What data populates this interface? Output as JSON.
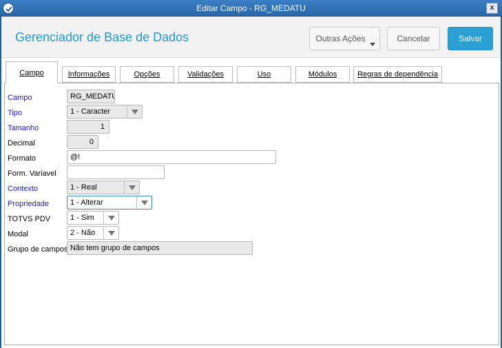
{
  "window": {
    "title": "Editar Campo - RG_MEDATU",
    "close_label": "x"
  },
  "header": {
    "title": "Gerenciador de Base de Dados",
    "buttons": {
      "more": "Outras Ações",
      "cancel": "Cancelar",
      "save": "Salvar"
    }
  },
  "tabs": [
    {
      "label": "Campo",
      "active": true
    },
    {
      "label": "Informações"
    },
    {
      "label": "Opções"
    },
    {
      "label": "Validações"
    },
    {
      "label": "Uso"
    },
    {
      "label": "Módulos"
    },
    {
      "label": "Regras de dependência"
    }
  ],
  "form": {
    "campo": {
      "label": "Campo",
      "value": "RG_MEDATU"
    },
    "tipo": {
      "label": "Tipo",
      "value": "1 - Caracter"
    },
    "tamanho": {
      "label": "Tamanho",
      "value": "1"
    },
    "decimal": {
      "label": "Decimal",
      "value": "0"
    },
    "formato": {
      "label": "Formato",
      "value": "@!"
    },
    "form_variavel": {
      "label": "Form. Variavel",
      "value": ""
    },
    "contexto": {
      "label": "Contexto",
      "value": "1 - Real"
    },
    "propriedade": {
      "label": "Propriedade",
      "value": "1 - Alterar"
    },
    "totvs_pdv": {
      "label": "TOTVS PDV",
      "value": "1 - Sim"
    },
    "modal": {
      "label": "Modal",
      "value": "2 - Não"
    },
    "grupo_campos": {
      "label": "Grupo de campos",
      "value": "Não tem grupo de campos"
    }
  },
  "colors": {
    "title_blue": "#1f9ac8",
    "save_button": "#2aa0d4",
    "required_label": "#1818c8"
  }
}
